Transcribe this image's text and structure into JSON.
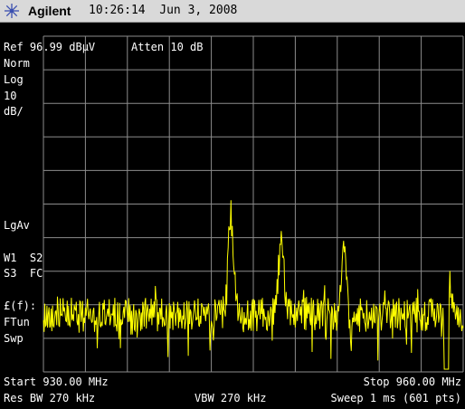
{
  "header": {
    "brand": "Agilent",
    "time_date": "10:26:14  Jun 3, 2008",
    "logo_icon": "agilent-spark-icon"
  },
  "settings": {
    "ref_level": "Ref 96.99 dBμV",
    "attenuation": "Atten 10 dB"
  },
  "left_annotations": {
    "detector_mode": "Norm",
    "scale_type": "Log",
    "scale_value": "10",
    "scale_unit": "dB/",
    "averaging": "LgAv",
    "trace_row1": "W1  S2",
    "trace_row2": "S3  FC",
    "marker_func": "£(f):",
    "ftun": "FTun",
    "swp": "Swp"
  },
  "footer": {
    "start": "Start 930.00 MHz",
    "stop": "Stop 960.00 MHz",
    "res_bw": "Res BW 270 kHz",
    "vbw": "VBW 270 kHz",
    "sweep": "Sweep 1 ms (601 pts)"
  },
  "colors": {
    "trace": "#ffff00",
    "grid": "#8c8c8c",
    "background": "#000000",
    "titlebar": "#d9d9d9"
  }
}
